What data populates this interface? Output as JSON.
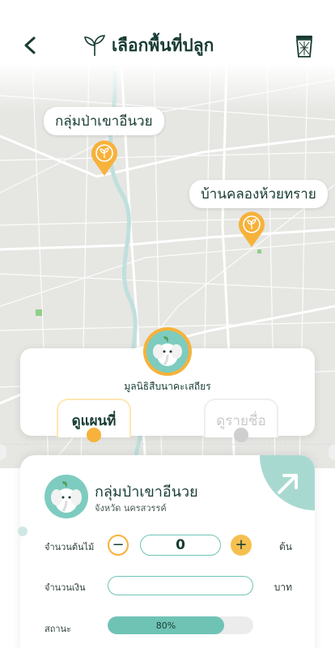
{
  "header": {
    "title": "เลือกพื้นที่ปลูก"
  },
  "map": {
    "pins": [
      {
        "label": "กลุ่มป่าเขาอีนวย"
      },
      {
        "label": "บ้านคลองห้วยทราย"
      }
    ]
  },
  "foundation": {
    "name": "มูลนิธิสืบนาคะเสถียร"
  },
  "tabs": {
    "map_label": "ดูแผนที่",
    "list_label": "ดูรายชื่อ",
    "active": "map"
  },
  "site": {
    "name": "กลุ่มป่าเขาอีนวย",
    "province": "จังหวัด นครสวรรค์"
  },
  "form": {
    "tree_count_label": "จำนวนต้นไม้",
    "tree_count_value": "0",
    "tree_unit": "ต้น",
    "minus": "−",
    "plus": "+",
    "amount_label": "จำนวนเงิน",
    "amount_value": "",
    "amount_unit": "บาท",
    "status_label": "สถานะ",
    "status_text": "80%",
    "status_fraction": 0.8
  },
  "colors": {
    "accent_teal": "#6fc3b5",
    "accent_orange": "#f6b23a",
    "text_dark": "#173b33"
  }
}
